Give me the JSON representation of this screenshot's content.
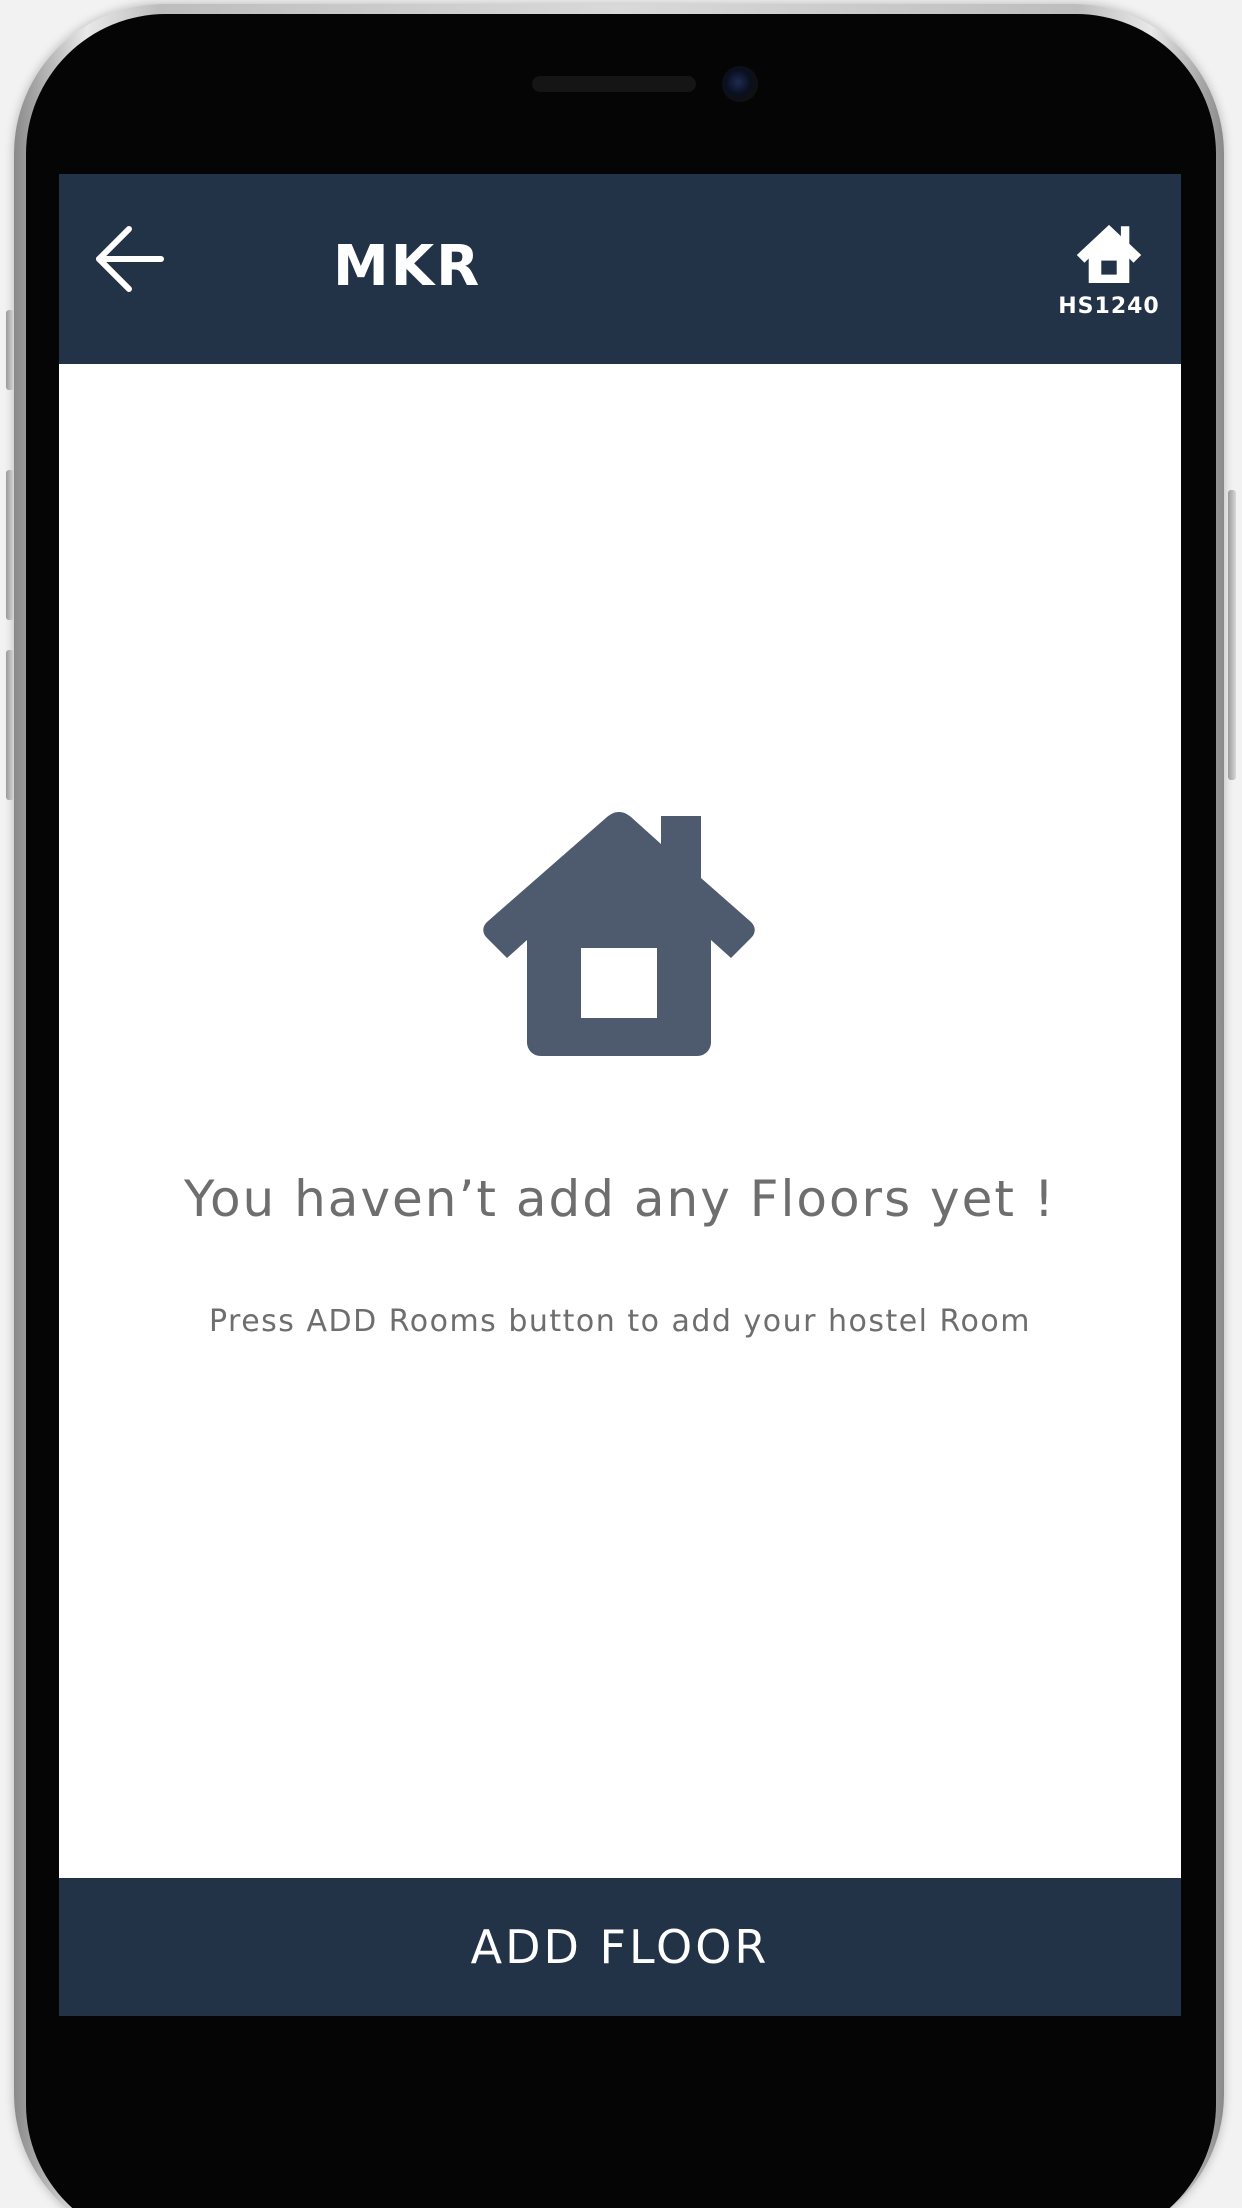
{
  "app_bar": {
    "title": "MKR",
    "hostel_code": "HS1240"
  },
  "empty_state": {
    "title": "You haven’t add any Floors yet !",
    "subtitle": "Press ADD Rooms button to add your hostel Room"
  },
  "footer": {
    "add_floor_label": "ADD FLOOR"
  },
  "icons": {
    "back": "arrow-left-icon",
    "hostel": "home-icon",
    "empty": "home-icon"
  },
  "colors": {
    "app_bar": "#223247",
    "empty_icon": "#4e5a6d",
    "text_gray": "#6e6e6e"
  }
}
